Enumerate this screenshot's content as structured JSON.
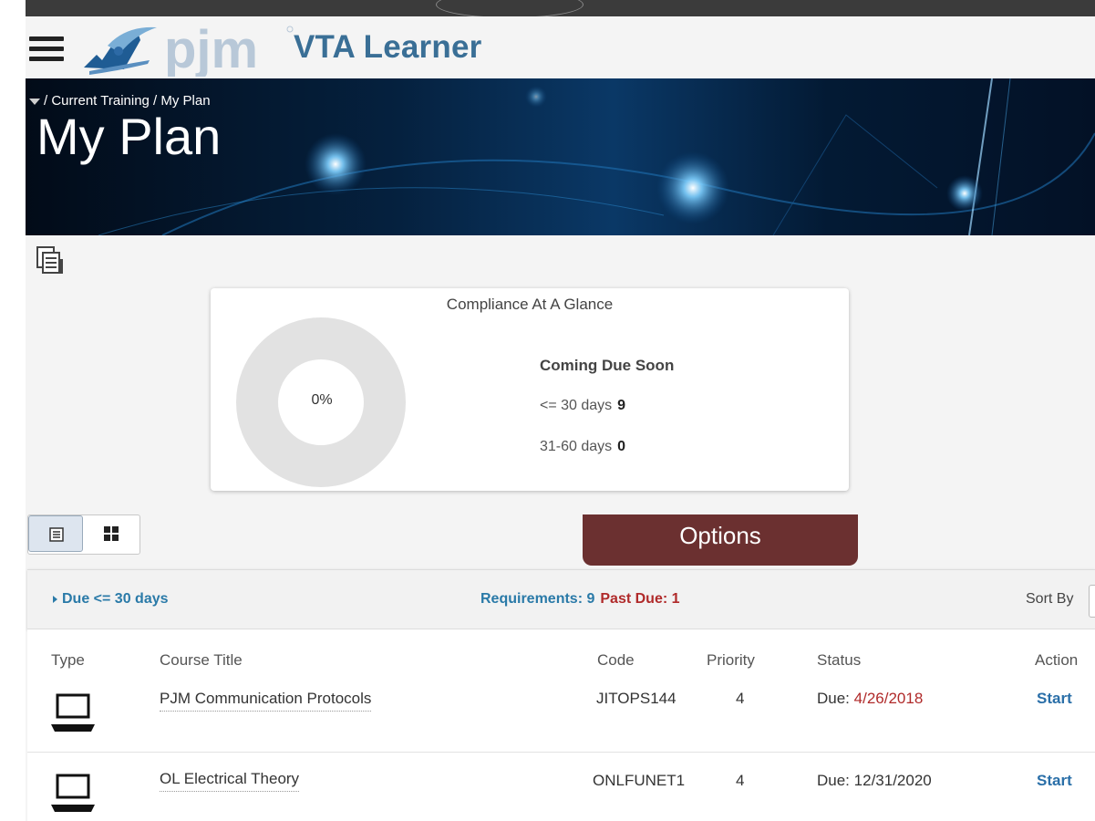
{
  "header": {
    "logo_text": "pjm",
    "app_title": "VTA Learner"
  },
  "banner": {
    "breadcrumb": "/ Current Training / My Plan",
    "page_title": "My Plan"
  },
  "compliance": {
    "title": "Compliance At A Glance",
    "percent_label": "0%",
    "percent_value": 0,
    "coming_due_heading": "Coming Due Soon",
    "rows": [
      {
        "label": "<= 30 days",
        "count": "9"
      },
      {
        "label": "31-60 days",
        "count": "0"
      }
    ]
  },
  "toolbar": {
    "options_label": "Options"
  },
  "filter": {
    "due_label": "Due <= 30 days",
    "requirements_label": "Requirements: 9",
    "past_due_label": "Past Due: 1",
    "sort_by_label": "Sort By"
  },
  "table": {
    "headers": {
      "type": "Type",
      "title": "Course Title",
      "code": "Code",
      "priority": "Priority",
      "status": "Status",
      "action": "Action"
    },
    "rows": [
      {
        "title": "PJM Communication Protocols",
        "code": "JITOPS144",
        "priority": "4",
        "status_prefix": "Due:",
        "status_date": "4/26/2018",
        "action": "Start"
      },
      {
        "title": "OL Electrical Theory",
        "code": "ONLFUNET1",
        "priority": "4",
        "status_prefix": "Due:",
        "status_date": "12/31/2020",
        "action": "Start"
      }
    ]
  },
  "colors": {
    "title_blue": "#3a6f96",
    "options_bg": "#6b3030",
    "past_due_red": "#b02a2a",
    "link_blue": "#2a7aa8"
  }
}
